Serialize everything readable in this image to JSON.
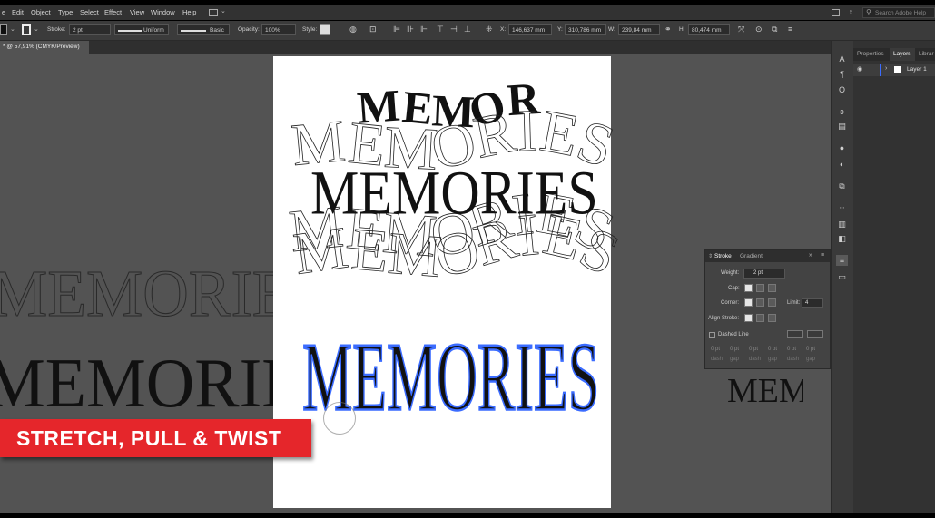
{
  "menu": {
    "items": [
      "e",
      "Edit",
      "Object",
      "Type",
      "Select",
      "Effect",
      "View",
      "Window",
      "Help"
    ],
    "search_placeholder": "Search Adobe Help"
  },
  "control": {
    "stroke_label": "Stroke:",
    "stroke_value": "2 pt",
    "profile_uniform": "Uniform",
    "brush_basic": "Basic",
    "opacity_label": "Opacity:",
    "opacity_value": "100%",
    "style_label": "Style:",
    "x_label": "X:",
    "x_value": "146,637 mm",
    "y_label": "Y:",
    "y_value": "310,786 mm",
    "w_label": "W:",
    "w_value": "239,84 mm",
    "h_label": "H:",
    "h_value": "80,474 mm"
  },
  "doc_tab": {
    "title": "* @ 57,91% (CMYK/Preview)"
  },
  "artwork": {
    "word": "MEMORIES",
    "partial_word": "MEM"
  },
  "panels": {
    "tabs": [
      "Properties",
      "Layers",
      "Librar"
    ],
    "layer_name": "Layer 1"
  },
  "stroke_panel": {
    "tab_stroke": "Stroke",
    "tab_gradient": "Gradient",
    "weight_label": "Weight:",
    "weight_value": "2 pt",
    "cap_label": "Cap:",
    "corner_label": "Corner:",
    "limit_label": "Limit:",
    "limit_value": "4",
    "align_label": "Align Stroke:",
    "dashed_label": "Dashed Line",
    "dash_labels": [
      "dash",
      "gap",
      "dash",
      "gap",
      "dash",
      "gap"
    ],
    "dash_values": [
      "0 pt",
      "0 pt",
      "0 pt",
      "0 pt",
      "0 pt",
      "0 pt"
    ]
  },
  "banner": {
    "text": "STRETCH, PULL & TWIST"
  },
  "colors": {
    "accent_red": "#e5262b",
    "selection_blue": "#3b6cff"
  }
}
